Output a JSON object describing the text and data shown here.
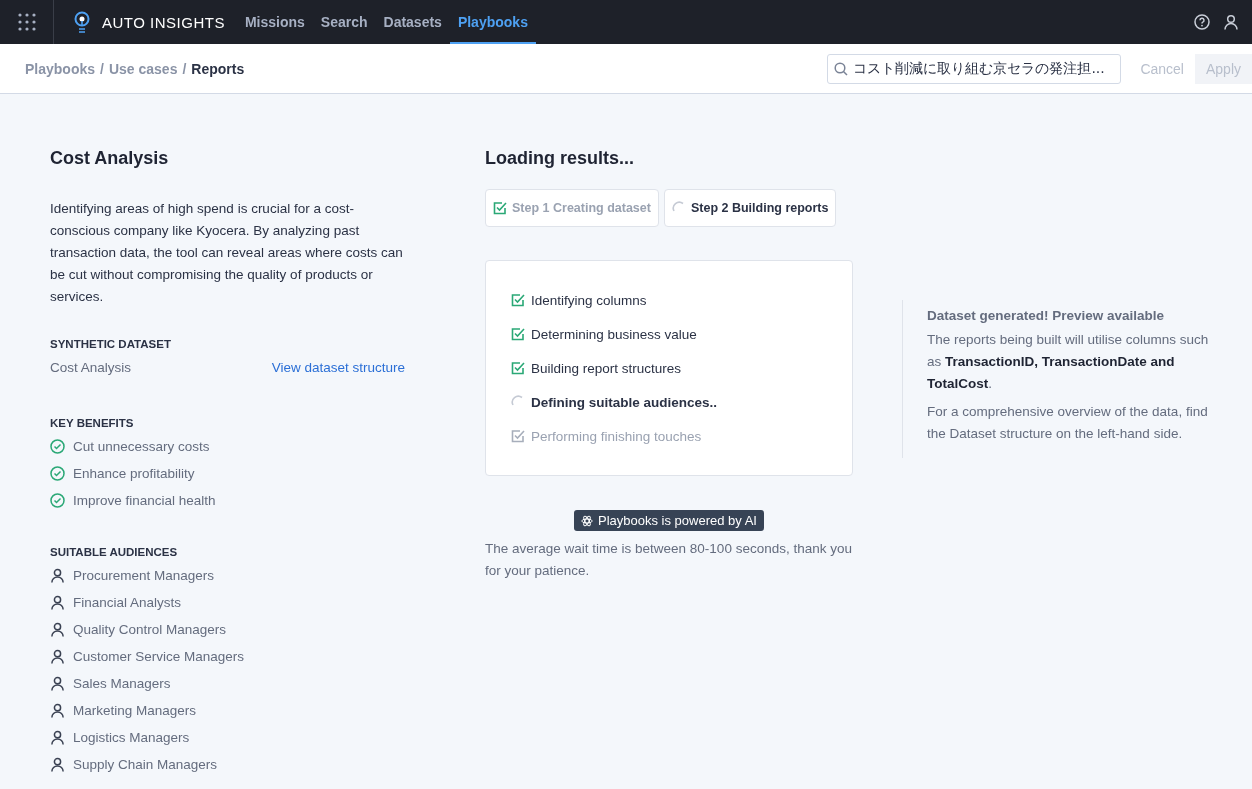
{
  "app": {
    "brand": "AUTO INSIGHTS"
  },
  "nav": [
    {
      "label": "Missions",
      "selected": false
    },
    {
      "label": "Search",
      "selected": false
    },
    {
      "label": "Datasets",
      "selected": false
    },
    {
      "label": "Playbooks",
      "selected": true
    }
  ],
  "breadcrumb": [
    {
      "label": "Playbooks",
      "current": false
    },
    {
      "label": "Use cases",
      "current": false
    },
    {
      "label": "Reports",
      "current": true
    }
  ],
  "breadcrumb_separator": "/",
  "search": {
    "value": "コスト削減に取り組む京セラの発注担..."
  },
  "actions": [
    {
      "label": "Cancel",
      "kind": "text",
      "disabled": true
    },
    {
      "label": "Apply",
      "kind": "filled",
      "disabled": true
    }
  ],
  "playbook": {
    "title": "Cost Analysis",
    "description": "Identifying areas of high spend is crucial for a cost-conscious company like Kyocera. By analyzing past transaction data, the tool can reveal areas where costs can be cut without compromising the quality of products or services.",
    "dataset_heading": "SYNTHETIC DATASET",
    "dataset_name": "Cost Analysis",
    "dataset_link": "View dataset structure",
    "benefits_heading": "KEY BENEFITS",
    "benefits": [
      "Cut unnecessary costs",
      "Enhance profitability",
      "Improve financial health"
    ],
    "audiences_heading": "SUITABLE AUDIENCES",
    "audiences": [
      "Procurement Managers",
      "Financial Analysts",
      "Quality Control Managers",
      "Customer Service Managers",
      "Sales Managers",
      "Marketing Managers",
      "Logistics Managers",
      "Supply Chain Managers"
    ]
  },
  "loading": {
    "title": "Loading results...",
    "steps": [
      {
        "label": "Step 1 Creating dataset",
        "done": true,
        "active": false
      },
      {
        "label": "Step 2 Building reports",
        "done": false,
        "active": true
      }
    ],
    "tasks": [
      {
        "label": "Identifying columns",
        "done": true,
        "active": false
      },
      {
        "label": "Determining business value",
        "done": true,
        "active": false
      },
      {
        "label": "Building report structures",
        "done": true,
        "active": false
      },
      {
        "label": "Defining suitable audiences..",
        "done": false,
        "active": true
      },
      {
        "label": "Performing finishing touches",
        "done": false,
        "active": false
      }
    ],
    "ai_badge": "Playbooks is powered by AI",
    "wait_note": "The average wait time is between 80-100 seconds, thank you for your patience."
  },
  "preview": {
    "title": "Dataset generated! Preview available",
    "paragraphs": [
      "The reports being built will utilise columns such as **TransactionID, TransactionDate and TotalCost**.",
      "For a comprehensive overview of the data, find the Dataset structure on the left-hand side."
    ]
  }
}
